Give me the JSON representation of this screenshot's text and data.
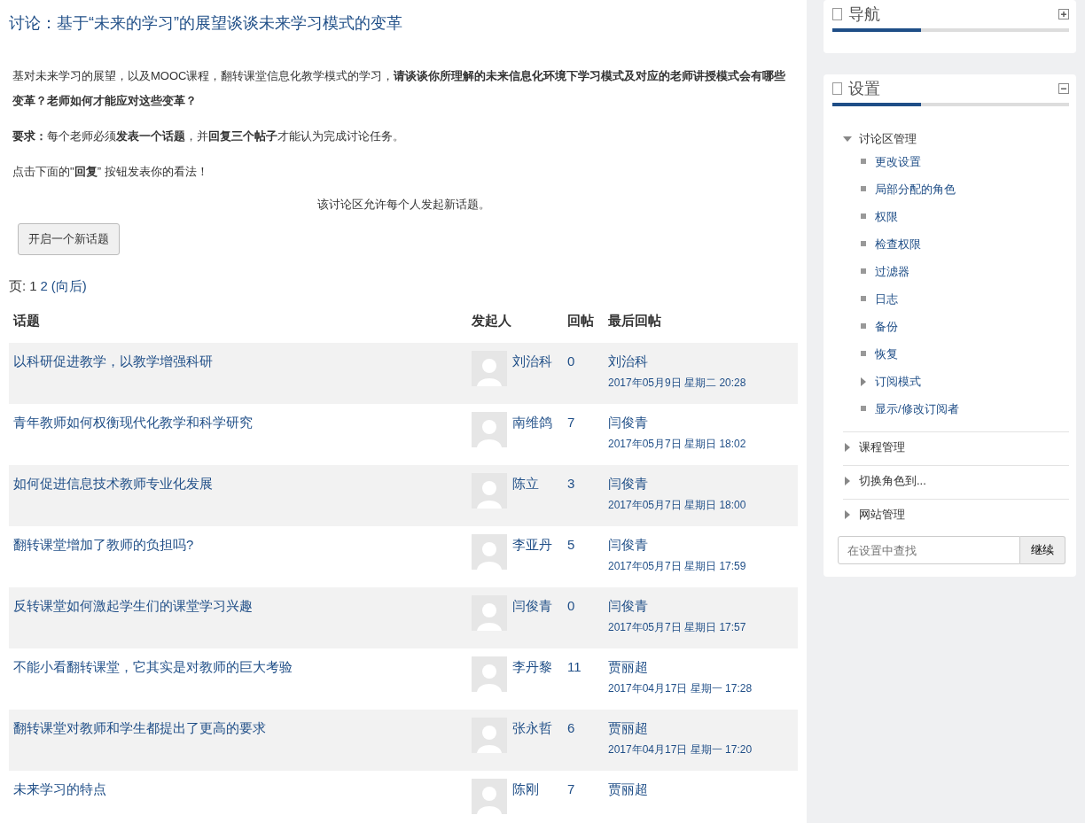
{
  "title": "讨论：基于“未来的学习”的展望谈谈未来学习模式的变革",
  "intro": [
    "基对未来学习的展望，以及MOOC课程，翻转课堂信息化教学模式的学习，**请谈谈你所理解的未来信息化环境下学习模式及对应的老师讲授模式会有哪些变革？老师如何才能应对这些变革？**",
    "**要求：**每个老师必须**发表一个话题**，并**回复三个帖子**才能认为完成讨论任务。",
    "点击下面的\"**回复**” 按钮发表你的看法！"
  ],
  "notice": "该讨论区允许每个人发起新话题。",
  "new_topic_button": "开启一个新话题",
  "paging": {
    "label": "页:",
    "pages": [
      {
        "label": "1",
        "selected": true
      },
      {
        "label": "2",
        "selected": false
      }
    ],
    "next": "(向后)"
  },
  "table": {
    "columns": [
      "话题",
      "发起人",
      "回帖",
      "最后回帖"
    ],
    "rows": [
      {
        "topic": "以科研促进教学，以教学增强科研",
        "starter": "刘治科",
        "replies": "0",
        "last_by": "刘治科",
        "last_time": "2017年05月9日 星期二 20:28"
      },
      {
        "topic": "青年教师如何权衡现代化教学和科学研究",
        "starter": "南维鸽",
        "replies": "7",
        "last_by": "闫俊青",
        "last_time": "2017年05月7日 星期日 18:02"
      },
      {
        "topic": "如何促进信息技术教师专业化发展",
        "starter": "陈立",
        "replies": "3",
        "last_by": "闫俊青",
        "last_time": "2017年05月7日 星期日 18:00"
      },
      {
        "topic": "翻转课堂增加了教师的负担吗?",
        "starter": "李亚丹",
        "replies": "5",
        "last_by": "闫俊青",
        "last_time": "2017年05月7日 星期日 17:59"
      },
      {
        "topic": "反转课堂如何激起学生们的课堂学习兴趣",
        "starter": "闫俊青",
        "replies": "0",
        "last_by": "闫俊青",
        "last_time": "2017年05月7日 星期日 17:57"
      },
      {
        "topic": "不能小看翻转课堂，它其实是对教师的巨大考验",
        "starter": "李丹黎",
        "replies": "11",
        "last_by": "贾丽超",
        "last_time": "2017年04月17日 星期一 17:28"
      },
      {
        "topic": "翻转课堂对教师和学生都提出了更高的要求",
        "starter": "张永哲",
        "replies": "6",
        "last_by": "贾丽超",
        "last_time": "2017年04月17日 星期一 17:20"
      },
      {
        "topic": "未来学习的特点",
        "starter": "陈刚",
        "replies": "7",
        "last_by": "贾丽超"
      }
    ]
  },
  "blocks": [
    {
      "title": "导航",
      "expanded": false
    },
    {
      "title": "设置",
      "expanded": true,
      "tree": [
        {
          "label": "讨论区管理",
          "kind": "branch",
          "expanded": true,
          "children": [
            {
              "label": "更改设置",
              "kind": "leaf"
            },
            {
              "label": "局部分配的角色",
              "kind": "leaf"
            },
            {
              "label": "权限",
              "kind": "leaf"
            },
            {
              "label": "检查权限",
              "kind": "leaf"
            },
            {
              "label": "过滤器",
              "kind": "leaf"
            },
            {
              "label": "日志",
              "kind": "leaf"
            },
            {
              "label": "备份",
              "kind": "leaf"
            },
            {
              "label": "恢复",
              "kind": "leaf"
            },
            {
              "label": "订阅模式",
              "kind": "branch",
              "expanded": false
            },
            {
              "label": "显示/修改订阅者",
              "kind": "leaf"
            }
          ]
        },
        {
          "label": "课程管理",
          "kind": "branch",
          "expanded": false
        },
        {
          "label": "切换角色到...",
          "kind": "branch",
          "expanded": false
        },
        {
          "label": "网站管理",
          "kind": "branch",
          "expanded": false
        }
      ],
      "search": {
        "placeholder": "在设置中查找",
        "button": "继续"
      }
    }
  ]
}
